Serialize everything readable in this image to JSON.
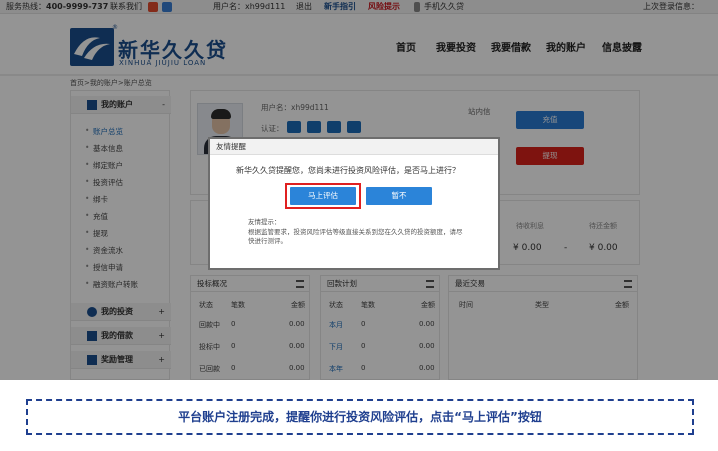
{
  "topbar": {
    "hotline_label": "服务热线：",
    "hotline_number": "400-9999-737",
    "contact": "联系我们",
    "user": "用户名：xh99d111",
    "logout": "退出",
    "guide": "新手指引",
    "risk": "风险提示",
    "mobile": "手机久久贷",
    "last_login": "上次登录信息："
  },
  "brand": {
    "cn": "新华久久贷",
    "en": "XINHUA JIUJIU LOAN",
    "reg": "®"
  },
  "nav": [
    "首页",
    "我要投资",
    "我要借款",
    "我的账户",
    "信息披露"
  ],
  "breadcrumb": "首页>我的账户>账户总览",
  "sidebar": {
    "sections": [
      {
        "label": "我的账户",
        "toggle": "-"
      },
      {
        "label": "我的投资",
        "toggle": "+"
      },
      {
        "label": "我的借款",
        "toggle": "+"
      },
      {
        "label": "奖励管理",
        "toggle": "+"
      }
    ],
    "items": [
      "账户总览",
      "基本信息",
      "绑定账户",
      "投资评估",
      "绑卡",
      "充值",
      "提现",
      "资金流水",
      "授信申请",
      "融资账户转账"
    ]
  },
  "profile": {
    "username": "用户名：xh99d111",
    "auth": "认证：",
    "site_msg": "站内信",
    "recharge": "充值",
    "withdraw": "提现"
  },
  "stats": {
    "labels": [
      "待收利息",
      "待还金额"
    ],
    "values": [
      "¥ 0.00",
      "¥ 0.00"
    ],
    "dash": "-"
  },
  "panels": {
    "invest": {
      "title": "投标概况",
      "cols": [
        "状态",
        "笔数",
        "金额"
      ],
      "rows": [
        [
          "回款中",
          "0",
          "0.00"
        ],
        [
          "投标中",
          "0",
          "0.00"
        ],
        [
          "已回款",
          "0",
          "0.00"
        ]
      ]
    },
    "repay": {
      "title": "回款计划",
      "cols": [
        "状态",
        "笔数",
        "金额"
      ],
      "rows": [
        [
          "本月",
          "0",
          "0.00"
        ],
        [
          "下月",
          "0",
          "0.00"
        ],
        [
          "本年",
          "0",
          "0.00"
        ]
      ]
    },
    "recent": {
      "title": "最近交易",
      "cols": [
        "时间",
        "类型",
        "金额"
      ]
    }
  },
  "dialog": {
    "title": "友情提醒",
    "message": "新华久久贷提醒您，您尚未进行投资风险评估，是否马上进行？",
    "confirm": "马上评估",
    "cancel": "暂不",
    "tip_title": "友情提示：",
    "tip_line1": "根据监管要求，投资风险评估等级直接关系到您在久久贷的投资额度，请尽",
    "tip_line2": "快进行测评。",
    "tip_line3": ""
  },
  "caption": "平台账户注册完成，提醒你进行投资风险评估，点击“马上评估”按钮",
  "colors": {
    "primary": "#2b84d9",
    "danger": "#d9221b",
    "brand": "#1b4f8e",
    "highlight": "#e02020"
  }
}
